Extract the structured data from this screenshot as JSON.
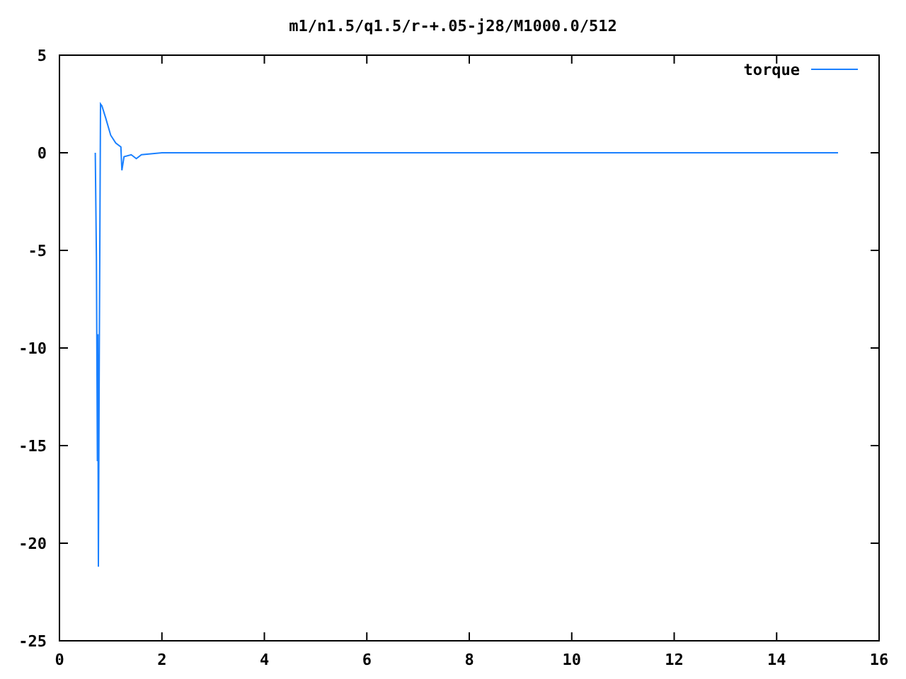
{
  "chart": {
    "chart_data": {
      "type": "line",
      "title": "m1/n1.5/q1.5/r-+.05-j28/M1000.0/512",
      "x": [
        0.7,
        0.72,
        0.74,
        0.75,
        0.76,
        0.78,
        0.8,
        0.83,
        0.9,
        1.0,
        1.1,
        1.2,
        1.22,
        1.26,
        1.4,
        1.5,
        1.6,
        2.0,
        15.2
      ],
      "series": [
        {
          "name": "torque",
          "color": "#1a80ff",
          "values": [
            0,
            -5.3,
            -15.8,
            -9.3,
            -21.2,
            -9.4,
            2.5,
            2.4,
            1.8,
            0.9,
            0.5,
            0.3,
            -0.9,
            -0.2,
            -0.1,
            -0.3,
            -0.1,
            0,
            0
          ]
        }
      ],
      "xlim": [
        0,
        16
      ],
      "ylim": [
        -25,
        5
      ],
      "xticks": [
        0,
        2,
        4,
        6,
        8,
        10,
        12,
        14,
        16
      ],
      "yticks": [
        -25,
        -20,
        -15,
        -10,
        -5,
        0,
        5
      ]
    }
  }
}
